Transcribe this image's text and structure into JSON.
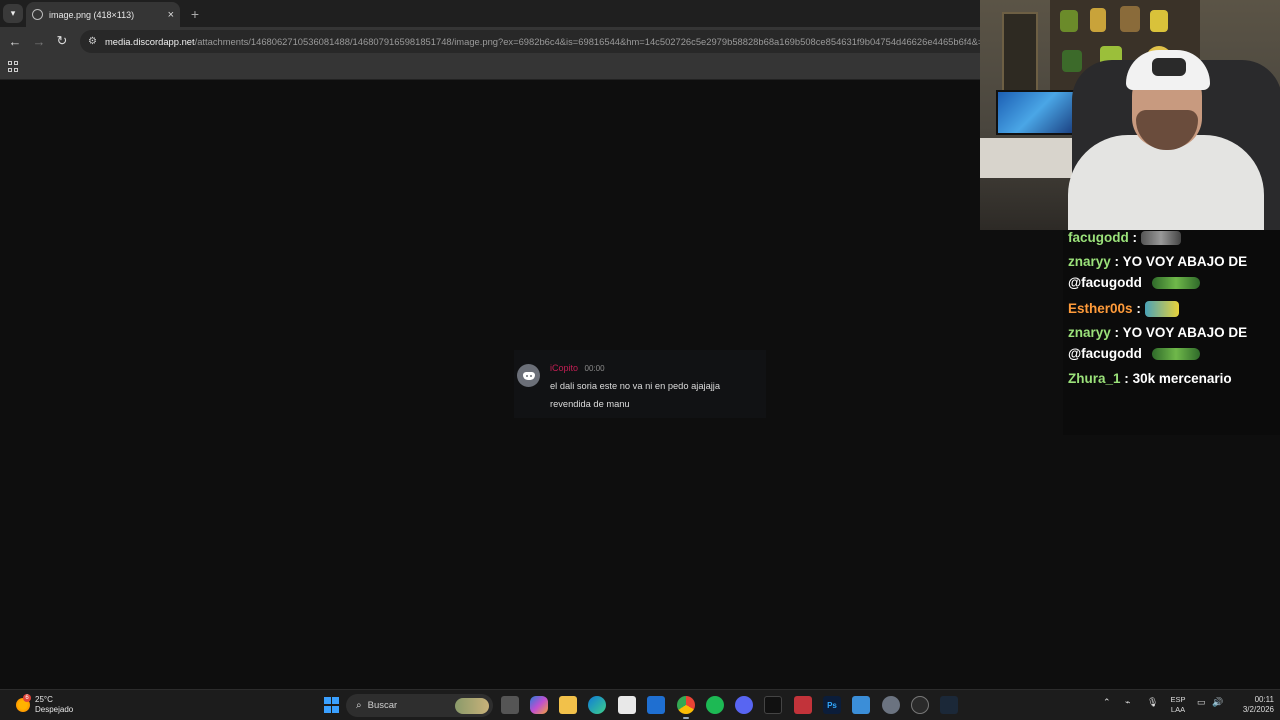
{
  "browser": {
    "tab": {
      "title": "image.png (418×113)"
    },
    "new_tab_label": "+",
    "url": {
      "host": "media.discordapp.net",
      "path": "/attachments/1468062710536081488/1468079165981851748/image.png?ex=6982b6c4&is=69816544&hm=14c502726c5e2979b58828b68a169b508ce854631f9b04754d46626e4465b6f4&=&"
    }
  },
  "discord_message": {
    "author": "iCopito",
    "time": "00:00",
    "text": "el dali soria este no va ni en pedo ajajajja revendida de manu",
    "author_color": "#c21e53"
  },
  "chat": {
    "messages": [
      {
        "user": "facugodd",
        "text": "",
        "color": "#9be27a",
        "emote": "emote-rifle"
      },
      {
        "user": "znaryy",
        "text": "YO VOY ABAJO DE",
        "color": "#9be27a"
      },
      {
        "user": "",
        "text": "@facugodd",
        "color": "#ffffff",
        "emote": "emote-lizard"
      },
      {
        "user": "Esther00s",
        "text": "",
        "color": "#ff9b3a",
        "emote": "emote-faces"
      },
      {
        "user": "znaryy",
        "text": "YO VOY ABAJO DE",
        "color": "#9be27a"
      },
      {
        "user": "",
        "text": "@facugodd",
        "color": "#ffffff",
        "emote": "emote-lizard"
      },
      {
        "user": "Zhura_1",
        "text": "30k mercenario",
        "color": "#9be27a"
      }
    ],
    "separator": ":"
  },
  "taskbar": {
    "weather_temp": "25°C",
    "weather_desc": "Despejado",
    "weather_badge": "6",
    "search_placeholder": "Buscar",
    "lang_line1": "ESP",
    "lang_line2": "LAA",
    "time": "00:11",
    "date": "3/2/2026",
    "apps": [
      "start-icon",
      "task-view-icon",
      "copilot-icon",
      "file-explorer-icon",
      "edge-icon",
      "store-icon",
      "mail-icon",
      "chrome-icon",
      "spotify-icon",
      "discord-icon",
      "capcut-icon",
      "video-app-icon",
      "photoshop-icon",
      "notepad-icon",
      "settings-icon",
      "github-icon",
      "steam-icon"
    ]
  }
}
